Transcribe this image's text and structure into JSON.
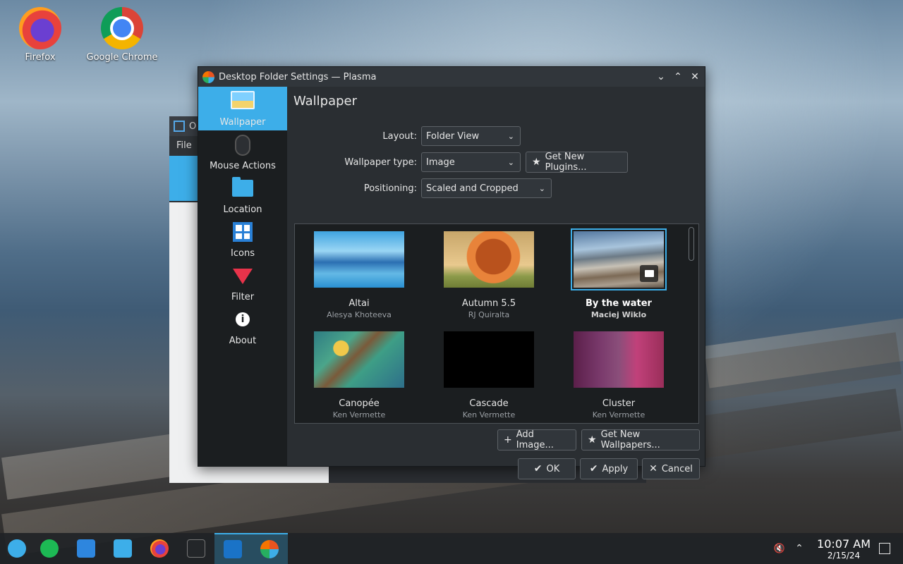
{
  "desktop": {
    "icons": [
      {
        "label": "Firefox"
      },
      {
        "label": "Google Chrome"
      }
    ]
  },
  "background_window": {
    "title": "O",
    "menu": "File"
  },
  "dialog": {
    "title": "Desktop Folder Settings — Plasma",
    "categories": [
      {
        "label": "Wallpaper",
        "icon": "wallpaper-icon",
        "active": true
      },
      {
        "label": "Mouse Actions",
        "icon": "mouse-icon"
      },
      {
        "label": "Location",
        "icon": "folder-icon"
      },
      {
        "label": "Icons",
        "icon": "icons-grid-icon"
      },
      {
        "label": "Filter",
        "icon": "filter-icon"
      },
      {
        "label": "About",
        "icon": "info-icon"
      }
    ],
    "page_title": "Wallpaper",
    "layout": {
      "label": "Layout:",
      "value": "Folder View"
    },
    "wallpaper_type": {
      "label": "Wallpaper type:",
      "value": "Image"
    },
    "get_new_plugins": "Get New Plugins...",
    "positioning": {
      "label": "Positioning:",
      "value": "Scaled and Cropped"
    },
    "wallpapers": [
      {
        "name": "Altai",
        "author": "Alesya Khoteeva"
      },
      {
        "name": "Autumn 5.5",
        "author": "RJ Quiralta"
      },
      {
        "name": "By the water",
        "author": "Maciej Wiklo",
        "selected": true
      },
      {
        "name": "Canopée",
        "author": "Ken Vermette"
      },
      {
        "name": "Cascade",
        "author": "Ken Vermette"
      },
      {
        "name": "Cluster",
        "author": "Ken Vermette"
      }
    ],
    "add_image": "Add Image...",
    "get_new_wallpapers": "Get New Wallpapers...",
    "ok": "OK",
    "apply": "Apply",
    "cancel": "Cancel"
  },
  "taskbar": {
    "clock_time": "10:07 AM",
    "clock_date": "2/15/24"
  },
  "colors": {
    "accent": "#3daee9",
    "window_bg": "#2a2e32",
    "sidebar_bg": "#1b1e20"
  }
}
